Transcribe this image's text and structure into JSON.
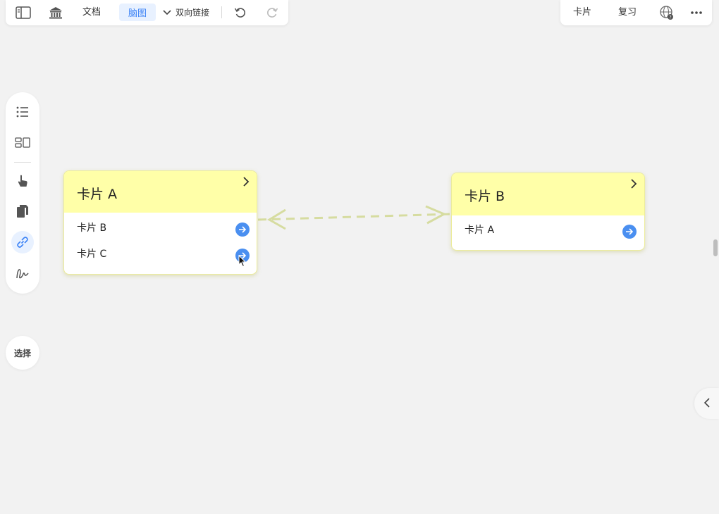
{
  "toolbar": {
    "doc_label": "文档",
    "mindmap_label": "脑图",
    "backlinks_label": "双向链接",
    "cards_label": "卡片",
    "review_label": "复习"
  },
  "palette": {
    "select_label": "选择"
  },
  "cards": [
    {
      "title": "卡片 A",
      "rows": [
        "卡片 B",
        "卡片 C"
      ]
    },
    {
      "title": "卡片 B",
      "rows": [
        "卡片 A"
      ]
    }
  ],
  "colors": {
    "card_header": "#ffffa8",
    "accent": "#4a8ff0",
    "link_line": "#d6dca0"
  },
  "icons": [
    "sidebar-toggle-icon",
    "library-icon",
    "chevron-down-icon",
    "undo-icon",
    "redo-icon",
    "www-help-icon",
    "more-icon",
    "outline-list-icon",
    "layout-icon",
    "pointer-hand-icon",
    "copy-pages-icon",
    "link-icon",
    "draw-squiggle-icon",
    "chevron-left-icon",
    "arrow-right-icon"
  ]
}
